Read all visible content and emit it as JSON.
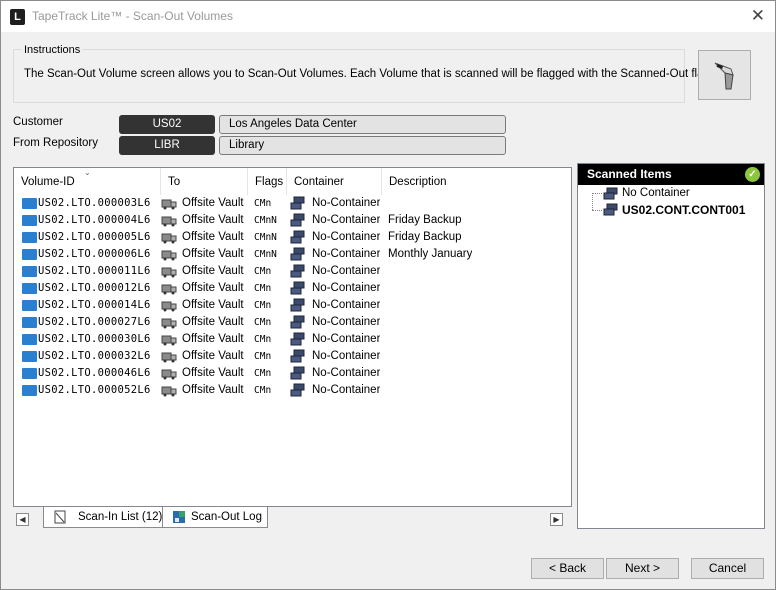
{
  "window": {
    "title": "TapeTrack Lite™ - Scan-Out Volumes",
    "app_icon_letter": "L",
    "close_glyph": "✕"
  },
  "instructions": {
    "title": "Instructions",
    "text": "The Scan-Out Volume screen allows you to Scan-Out Volumes. Each Volume that is scanned will be flagged with the Scanned-Out flag."
  },
  "customer": {
    "label": "Customer",
    "code": "US02",
    "name": "Los Angeles Data Center"
  },
  "repository": {
    "label": "From Repository",
    "code": "LIBR",
    "name": "Library"
  },
  "table": {
    "columns": [
      "Volume-ID",
      "To",
      "Flags",
      "Container",
      "Description"
    ],
    "rows": [
      {
        "volume_id": "US02.LTO.000003L6",
        "to": "Offsite Vault",
        "flags": "CMn",
        "container": "No-Container",
        "description": ""
      },
      {
        "volume_id": "US02.LTO.000004L6",
        "to": "Offsite Vault",
        "flags": "CMnN",
        "container": "No-Container",
        "description": "Friday Backup"
      },
      {
        "volume_id": "US02.LTO.000005L6",
        "to": "Offsite Vault",
        "flags": "CMnN",
        "container": "No-Container",
        "description": "Friday Backup"
      },
      {
        "volume_id": "US02.LTO.000006L6",
        "to": "Offsite Vault",
        "flags": "CMnN",
        "container": "No-Container",
        "description": "Monthly January"
      },
      {
        "volume_id": "US02.LTO.000011L6",
        "to": "Offsite Vault",
        "flags": "CMn",
        "container": "No-Container",
        "description": ""
      },
      {
        "volume_id": "US02.LTO.000012L6",
        "to": "Offsite Vault",
        "flags": "CMn",
        "container": "No-Container",
        "description": ""
      },
      {
        "volume_id": "US02.LTO.000014L6",
        "to": "Offsite Vault",
        "flags": "CMn",
        "container": "No-Container",
        "description": ""
      },
      {
        "volume_id": "US02.LTO.000027L6",
        "to": "Offsite Vault",
        "flags": "CMn",
        "container": "No-Container",
        "description": ""
      },
      {
        "volume_id": "US02.LTO.000030L6",
        "to": "Offsite Vault",
        "flags": "CMn",
        "container": "No-Container",
        "description": ""
      },
      {
        "volume_id": "US02.LTO.000032L6",
        "to": "Offsite Vault",
        "flags": "CMn",
        "container": "No-Container",
        "description": ""
      },
      {
        "volume_id": "US02.LTO.000046L6",
        "to": "Offsite Vault",
        "flags": "CMn",
        "container": "No-Container",
        "description": ""
      },
      {
        "volume_id": "US02.LTO.000052L6",
        "to": "Offsite Vault",
        "flags": "CMn",
        "container": "No-Container",
        "description": ""
      }
    ]
  },
  "scanned": {
    "title": "Scanned Items",
    "items": [
      "No Container",
      "US02.CONT.CONT001"
    ]
  },
  "tabs": [
    {
      "label": "Scan-In List (12)",
      "icon": "document-icon"
    },
    {
      "label": "Scan-Out Log",
      "icon": "log-icon"
    }
  ],
  "scroll": {
    "left": "◀",
    "right": "▶"
  },
  "buttons": {
    "back": "< Back",
    "next": "Next >",
    "cancel": "Cancel"
  },
  "colors": {
    "code_pill": "#333333",
    "volume_icon": "#2b7fd0",
    "check": "#8cc63f"
  }
}
